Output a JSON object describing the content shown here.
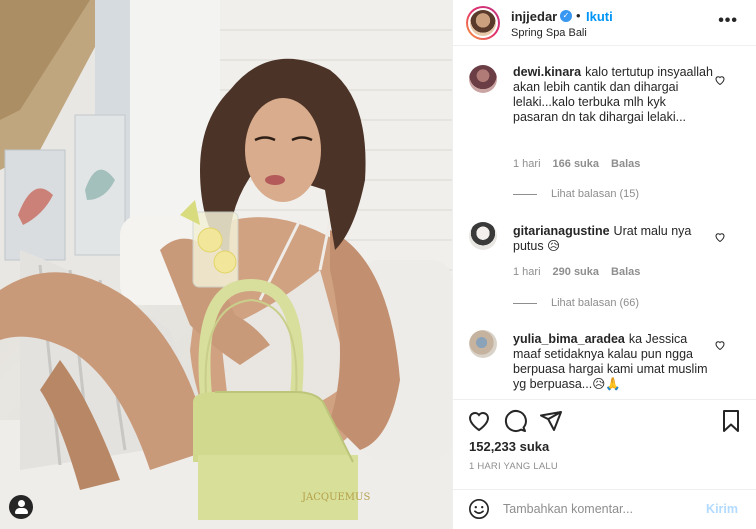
{
  "header": {
    "username": "injjedar",
    "follow_label": "Ikuti",
    "separator": "•",
    "location": "Spring Spa Bali",
    "more_label": "•••"
  },
  "comments": [
    {
      "username": "dewi.kinara",
      "text": "kalo tertutup insyaallah akan lebih cantik dan dihargai lelaki...kalo terbuka mlh kyk pasaran dn tak dihargai lelaki...",
      "time": "1 hari",
      "likes": "166 suka",
      "reply": "Balas",
      "view_replies": "Lihat balasan (15)"
    },
    {
      "username": "gitarianagustine",
      "text": "Urat malu nya putus 😥",
      "time": "1 hari",
      "likes": "290 suka",
      "reply": "Balas",
      "view_replies": "Lihat balasan (66)"
    },
    {
      "username": "yulia_bima_aradea",
      "text": "ka Jessica maaf setidaknya kalau pun ngga berpuasa hargai kami umat muslim yg berpuasa...😥🙏"
    }
  ],
  "post": {
    "likes": "152,233 suka",
    "timestamp": "1 HARI YANG LALU",
    "bag_brand": "JACQUEMUS"
  },
  "add_comment": {
    "placeholder": "Tambahkan komentar...",
    "post_label": "Kirim"
  },
  "colors": {
    "link": "#0095f6",
    "verified": "#3897f0",
    "muted": "#8e8e8e",
    "text": "#262626",
    "post_disabled": "#b3dbff"
  },
  "icons": [
    "verified-badge-icon",
    "more-options-icon",
    "heart-icon",
    "comment-icon",
    "share-icon",
    "bookmark-icon",
    "emoji-icon",
    "tagged-user-icon"
  ]
}
